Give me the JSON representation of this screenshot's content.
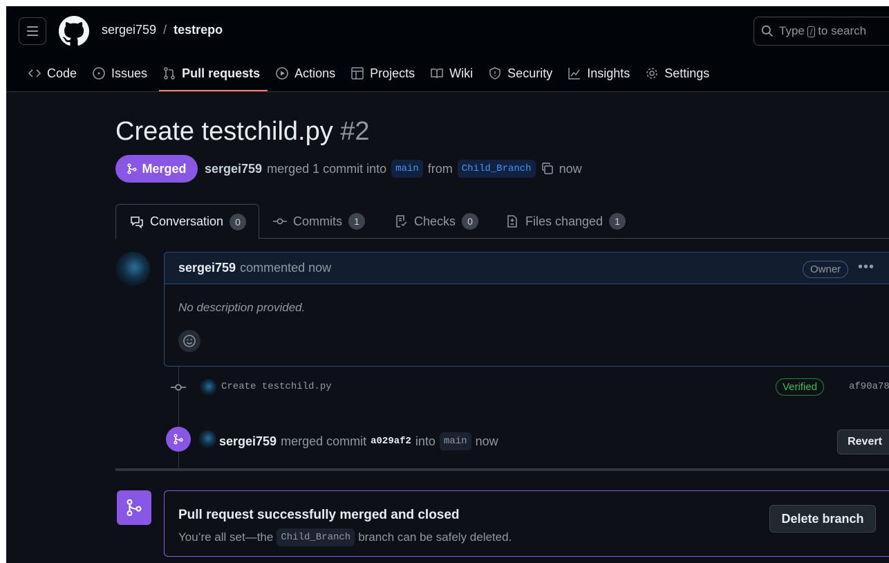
{
  "header": {
    "owner": "sergei759",
    "separator": "/",
    "repo": "testrepo",
    "search_placeholder_prefix": "Type",
    "search_key": "/",
    "search_placeholder_suffix": "to search"
  },
  "nav": {
    "items": [
      {
        "label": "Code",
        "icon": "code-icon"
      },
      {
        "label": "Issues",
        "icon": "issue-icon"
      },
      {
        "label": "Pull requests",
        "icon": "pull-request-icon",
        "active": true
      },
      {
        "label": "Actions",
        "icon": "play-icon"
      },
      {
        "label": "Projects",
        "icon": "table-icon"
      },
      {
        "label": "Wiki",
        "icon": "book-icon"
      },
      {
        "label": "Security",
        "icon": "shield-icon"
      },
      {
        "label": "Insights",
        "icon": "graph-icon"
      },
      {
        "label": "Settings",
        "icon": "gear-icon"
      }
    ]
  },
  "pr": {
    "title": "Create testchild.py",
    "number": "#2",
    "state": "Merged",
    "author": "sergei759",
    "merged_text": "merged 1 commit into",
    "base": "main",
    "from": "from",
    "head": "Child_Branch",
    "time": "now"
  },
  "tabs": [
    {
      "label": "Conversation",
      "count": "0",
      "icon": "comment-discussion-icon"
    },
    {
      "label": "Commits",
      "count": "1",
      "icon": "commit-icon"
    },
    {
      "label": "Checks",
      "count": "0",
      "icon": "checklist-icon"
    },
    {
      "label": "Files changed",
      "count": "1",
      "icon": "file-diff-icon"
    }
  ],
  "comment": {
    "author": "sergei759",
    "action": "commented now",
    "role": "Owner",
    "body": "No description provided."
  },
  "commit": {
    "message": "Create testchild.py",
    "badge": "Verified",
    "sha": "af90a78"
  },
  "merge_event": {
    "author": "sergei759",
    "text": "merged commit",
    "sha": "a029af2",
    "into": "into",
    "branch": "main",
    "time": "now",
    "revert_label": "Revert"
  },
  "final": {
    "title": "Pull request successfully merged and closed",
    "sub_prefix": "You’re all set—the",
    "branch": "Child_Branch",
    "sub_suffix": "branch can be safely deleted.",
    "delete_label": "Delete branch"
  },
  "colors": {
    "merged": "#8957e5",
    "background": "#0d1117",
    "active_tab_underline": "#f78166",
    "verified": "#3fb950"
  }
}
